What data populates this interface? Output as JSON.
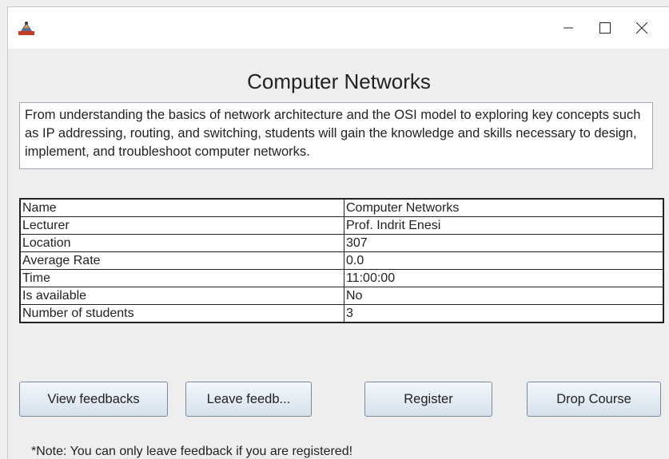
{
  "window": {
    "title": "",
    "controls": {
      "minimize_icon": "minimize-icon",
      "maximize_icon": "maximize-icon",
      "close_icon": "close-icon"
    }
  },
  "course": {
    "title": "Computer Networks",
    "description": "From understanding the basics of network architecture and the OSI model to exploring key concepts such as IP addressing, routing, and switching, students will gain the knowledge and skills necessary to design, implement, and troubleshoot computer networks."
  },
  "details": [
    {
      "label": "Name",
      "value": "Computer Networks"
    },
    {
      "label": "Lecturer",
      "value": "Prof. Indrit Enesi"
    },
    {
      "label": "Location",
      "value": "307"
    },
    {
      "label": "Average Rate",
      "value": "0.0"
    },
    {
      "label": "Time",
      "value": "11:00:00"
    },
    {
      "label": "Is available",
      "value": "No"
    },
    {
      "label": "Number of students",
      "value": "3"
    }
  ],
  "actions": {
    "view_feedbacks": "View feedbacks",
    "leave_feedback": "Leave feedb...",
    "register": "Register",
    "drop_course": "Drop Course"
  },
  "note": "*Note: You can only leave feedback if you are registered!"
}
